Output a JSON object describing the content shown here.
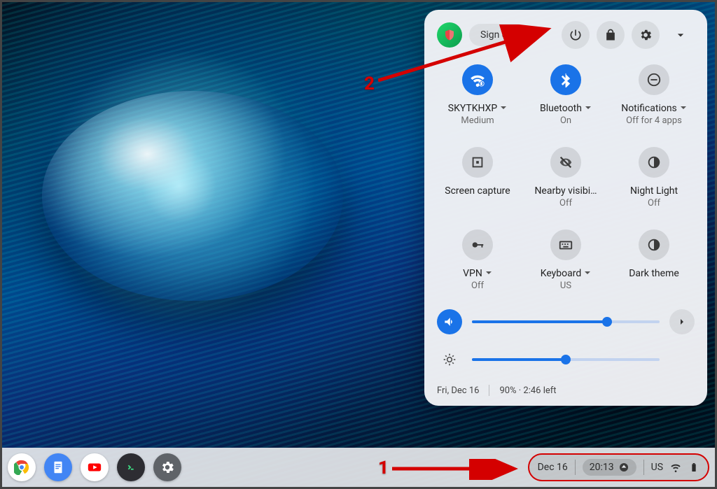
{
  "panel": {
    "signout_label": "Sign out",
    "tiles": {
      "wifi": {
        "label": "SKYTKHXP",
        "sub": "Medium"
      },
      "bluetooth": {
        "label": "Bluetooth",
        "sub": "On"
      },
      "notifications": {
        "label": "Notifications",
        "sub": "Off for 4 apps"
      },
      "screencap": {
        "label": "Screen capture",
        "sub": ""
      },
      "nearby": {
        "label": "Nearby visibi…",
        "sub": "Off"
      },
      "nightlight": {
        "label": "Night Light",
        "sub": "Off"
      },
      "vpn": {
        "label": "VPN",
        "sub": "Off"
      },
      "keyboard": {
        "label": "Keyboard",
        "sub": "US"
      },
      "darktheme": {
        "label": "Dark theme",
        "sub": ""
      }
    },
    "volume_percent": 72,
    "brightness_percent": 50,
    "footer": {
      "date": "Fri, Dec 16",
      "battery": "90% · 2:46 left"
    }
  },
  "shelf": {
    "date": "Dec 16",
    "time": "20:13",
    "ime": "US"
  },
  "annotations": {
    "label1": "1",
    "label2": "2"
  }
}
